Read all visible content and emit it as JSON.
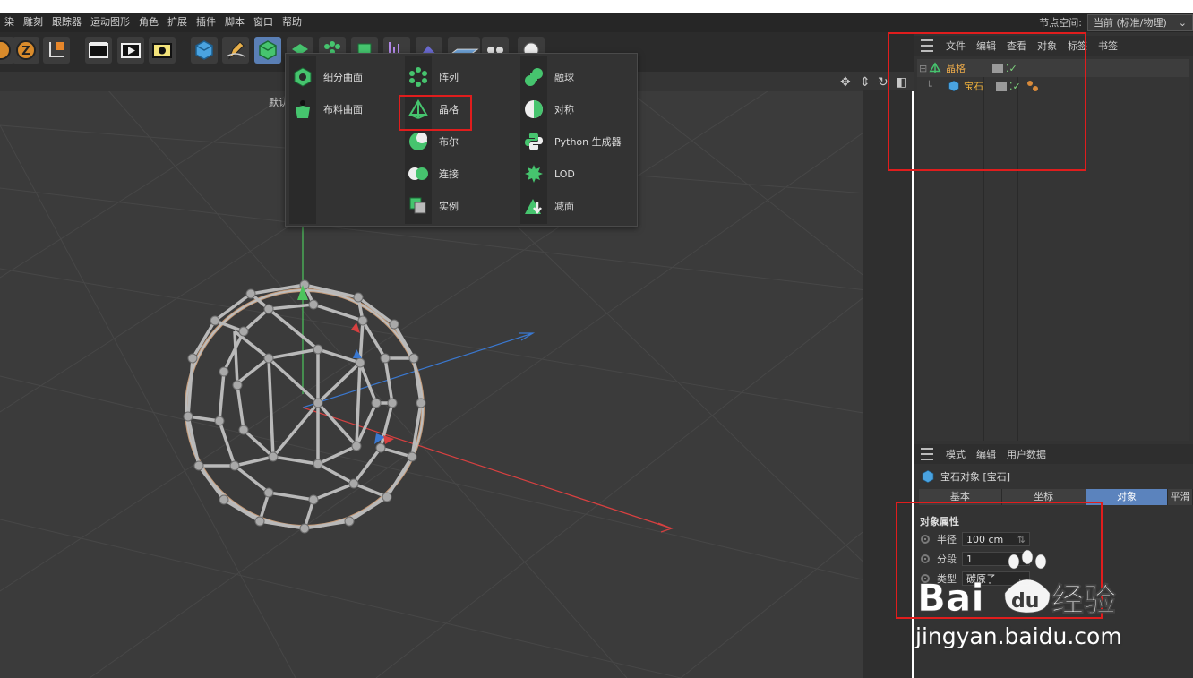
{
  "menubar": {
    "items": [
      "染",
      "雕刻",
      "跟踪器",
      "运动图形",
      "角色",
      "扩展",
      "插件",
      "脚本",
      "窗口",
      "帮助"
    ],
    "nodespace_label": "节点空间:",
    "nodespace_value": "当前 (标准/物理)"
  },
  "toolbar": {
    "icons": [
      "z-axis-icon",
      "z-lock-icon",
      "coordinate-icon",
      "render-region-icon",
      "render-view-icon",
      "render-settings-icon",
      "cube-icon",
      "pen-icon",
      "generator-icon",
      "deformer-icon",
      "array-icon",
      "mograph-icon",
      "chart-icon",
      "terrain-icon",
      "floor-icon",
      "light-icon"
    ]
  },
  "viewport": {
    "camera_label": "默认"
  },
  "popup": {
    "col1": [
      {
        "label": "细分曲面",
        "icon": "subdivision-surface-icon"
      },
      {
        "label": "布料曲面",
        "icon": "cloth-surface-icon"
      }
    ],
    "col2": [
      {
        "label": "阵列",
        "icon": "array-icon"
      },
      {
        "label": "晶格",
        "icon": "atom-array-icon"
      },
      {
        "label": "布尔",
        "icon": "boole-icon"
      },
      {
        "label": "连接",
        "icon": "connect-icon"
      },
      {
        "label": "实例",
        "icon": "instance-icon"
      }
    ],
    "col3": [
      {
        "label": "融球",
        "icon": "metaball-icon"
      },
      {
        "label": "对称",
        "icon": "symmetry-icon"
      },
      {
        "label": "Python 生成器",
        "icon": "python-icon"
      },
      {
        "label": "LOD",
        "icon": "lod-icon"
      },
      {
        "label": "减面",
        "icon": "polygon-reduction-icon"
      }
    ]
  },
  "object_manager": {
    "menu": [
      "文件",
      "编辑",
      "查看",
      "对象",
      "标签",
      "书签"
    ],
    "objects": [
      {
        "name": "晶格",
        "color": "#e8a84a"
      },
      {
        "name": "宝石",
        "color": "#f0b23c"
      }
    ]
  },
  "attribute_manager": {
    "menu": [
      "模式",
      "编辑",
      "用户数据"
    ],
    "title": "宝石对象 [宝石]",
    "tabs": [
      "基本",
      "坐标",
      "对象",
      "平滑"
    ],
    "section": "对象属性",
    "fields": [
      {
        "label": "半径",
        "value": "100 cm"
      },
      {
        "label": "分段",
        "value": "1"
      },
      {
        "label": "类型",
        "value": "碳原子"
      }
    ]
  },
  "watermark": {
    "logo_text": "Bai",
    "logo_mid": "du",
    "logo_cn": "经验",
    "url": "jingyan.baidu.com"
  },
  "colors": {
    "highlight_red": "#e01d1d",
    "active_tab": "#5b83bd",
    "object_orange": "#e8a84a"
  }
}
